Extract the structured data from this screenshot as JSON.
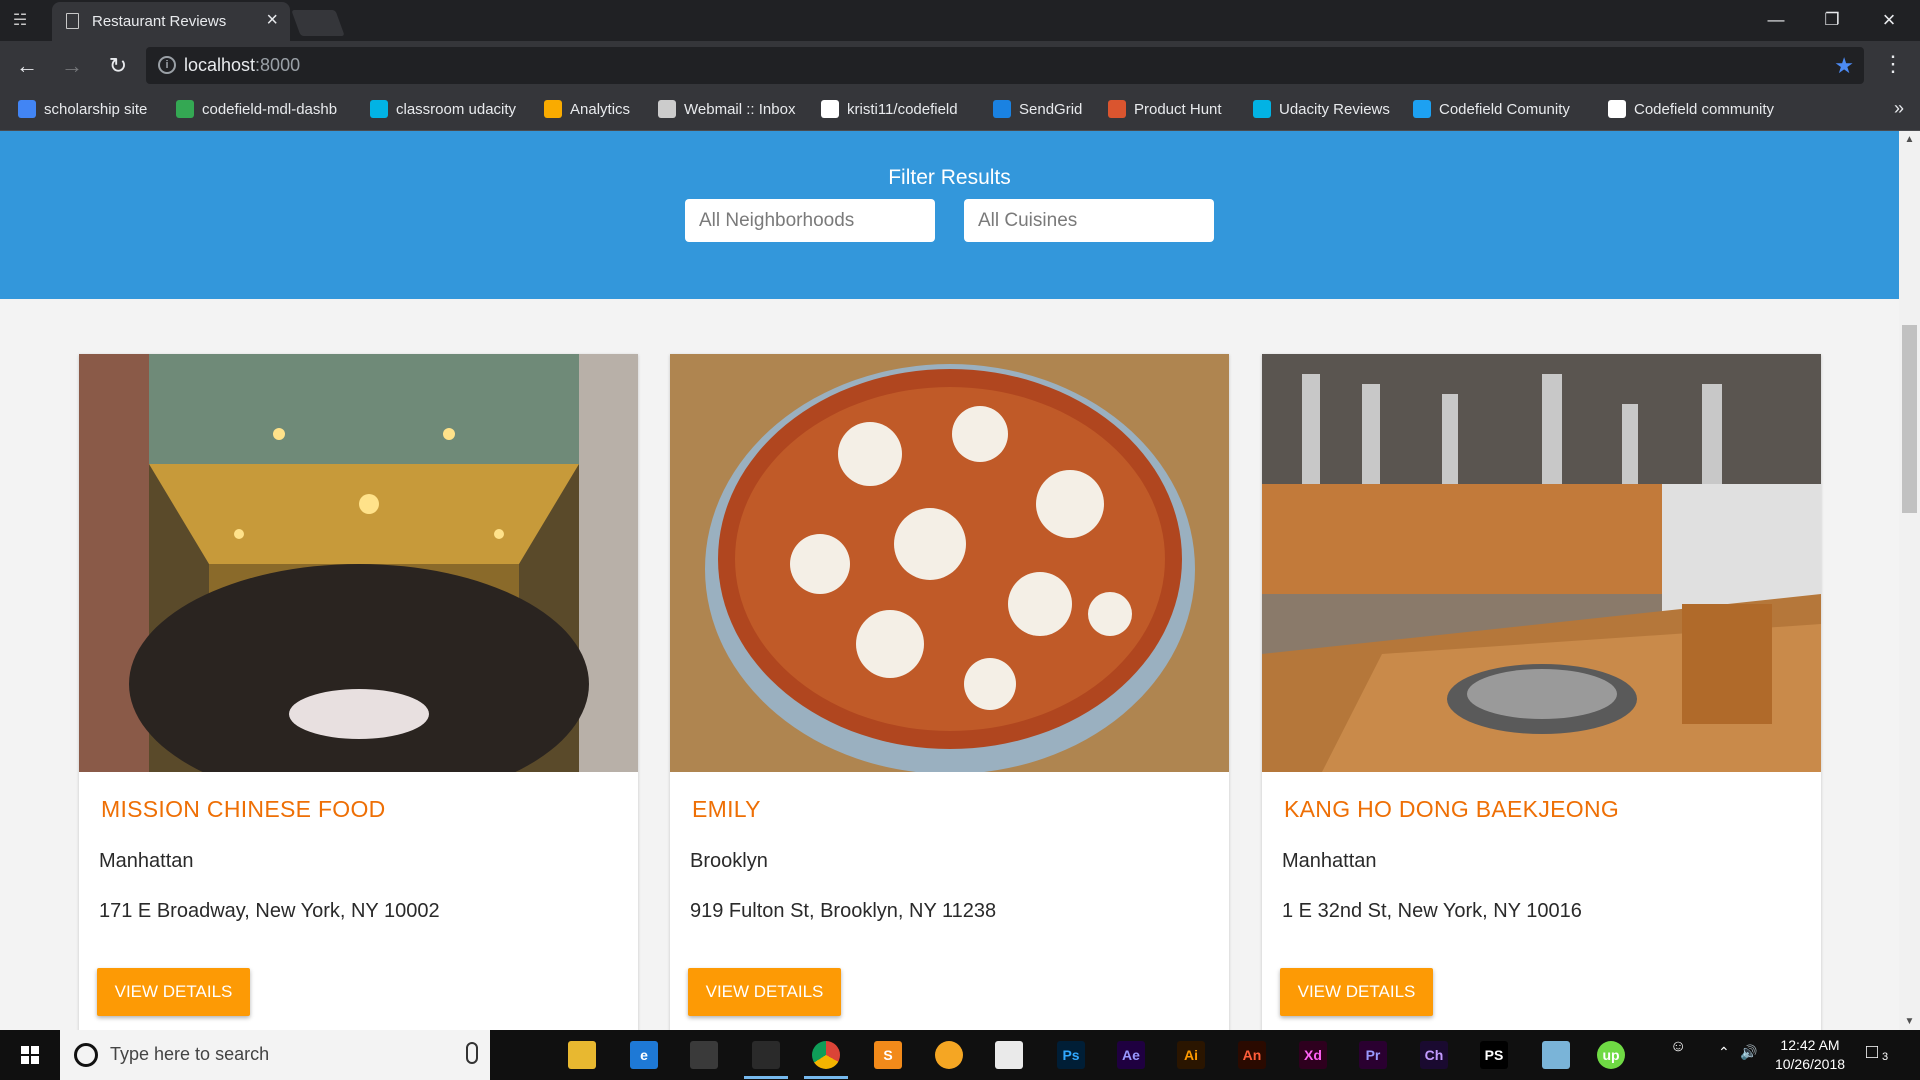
{
  "browser": {
    "tab_title": "Restaurant Reviews",
    "url_host": "localhost",
    "url_port": ":8000",
    "bookmarks": [
      {
        "label": "scholarship site",
        "icon": "calendar-icon",
        "color": "#4285f4"
      },
      {
        "label": "codefield-mdl-dashb",
        "icon": "check-circle-icon",
        "color": "#34a853"
      },
      {
        "label": "classroom udacity",
        "icon": "udacity-icon",
        "color": "#02b3e4"
      },
      {
        "label": "Analytics",
        "icon": "analytics-icon",
        "color": "#f9ab00"
      },
      {
        "label": "Webmail :: Inbox",
        "icon": "mail-icon",
        "color": "#cccccc"
      },
      {
        "label": "kristi11/codefield",
        "icon": "github-icon",
        "color": "#ffffff"
      },
      {
        "label": "SendGrid",
        "icon": "sendgrid-icon",
        "color": "#1a82e2"
      },
      {
        "label": "Product Hunt",
        "icon": "producthunt-icon",
        "color": "#da552f"
      },
      {
        "label": "Udacity Reviews",
        "icon": "udacity-icon",
        "color": "#02b3e4"
      },
      {
        "label": "Codefield Comunity",
        "icon": "twitter-icon",
        "color": "#1da1f2"
      },
      {
        "label": "Codefield community",
        "icon": "medium-icon",
        "color": "#ffffff"
      }
    ]
  },
  "filter": {
    "title": "Filter Results",
    "neighborhood_value": "All Neighborhoods",
    "cuisine_value": "All Cuisines"
  },
  "restaurants": [
    {
      "name": "MISSION CHINESE FOOD",
      "neighborhood": "Manhattan",
      "address": "171 E Broadway, New York, NY 10002",
      "button": "VIEW DETAILS"
    },
    {
      "name": "EMILY",
      "neighborhood": "Brooklyn",
      "address": "919 Fulton St, Brooklyn, NY 11238",
      "button": "VIEW DETAILS"
    },
    {
      "name": "KANG HO DONG BAEKJEONG",
      "neighborhood": "Manhattan",
      "address": "1 E 32nd St, New York, NY 10016",
      "button": "VIEW DETAILS"
    }
  ],
  "taskbar": {
    "search_placeholder": "Type here to search",
    "time": "12:42 AM",
    "date": "10/26/2018",
    "notification_count": "3",
    "apps": [
      {
        "icon": "task-view-icon",
        "label": ""
      },
      {
        "icon": "file-explorer-icon",
        "label": ""
      },
      {
        "icon": "edge-icon",
        "label": "e"
      },
      {
        "icon": "store-icon",
        "label": ""
      },
      {
        "icon": "git-icon",
        "label": ""
      },
      {
        "icon": "chrome-icon",
        "label": ""
      },
      {
        "icon": "sublime-icon",
        "label": "S"
      },
      {
        "icon": "chrome-canary-icon",
        "label": ""
      },
      {
        "icon": "mail-icon",
        "label": ""
      },
      {
        "icon": "photoshop-icon",
        "label": "Ps"
      },
      {
        "icon": "after-effects-icon",
        "label": "Ae"
      },
      {
        "icon": "illustrator-icon",
        "label": "Ai"
      },
      {
        "icon": "animate-icon",
        "label": "An"
      },
      {
        "icon": "xd-icon",
        "label": "Xd"
      },
      {
        "icon": "premiere-icon",
        "label": "Pr"
      },
      {
        "icon": "character-animator-icon",
        "label": "Ch"
      },
      {
        "icon": "phpstorm-icon",
        "label": "PS"
      },
      {
        "icon": "notepad-icon",
        "label": ""
      },
      {
        "icon": "upwork-icon",
        "label": "up"
      }
    ]
  }
}
